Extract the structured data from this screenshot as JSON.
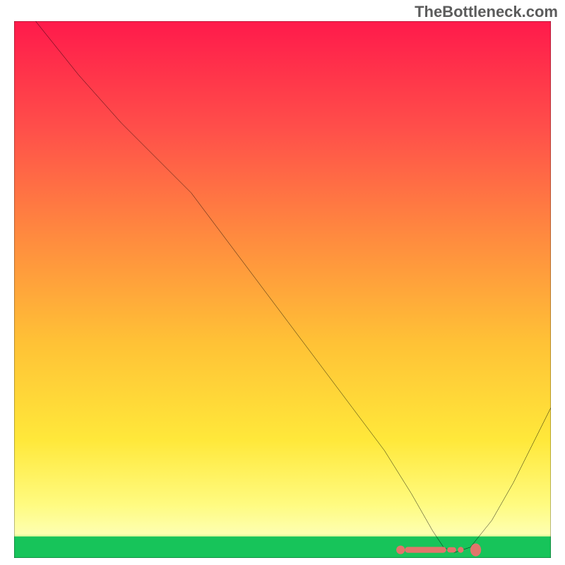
{
  "watermark": "TheBottleneck.com",
  "chart_data": {
    "type": "line",
    "title": "",
    "xlabel": "",
    "ylabel": "",
    "xlim": [
      0,
      100
    ],
    "ylim": [
      0,
      100
    ],
    "grid": false,
    "series": [
      {
        "name": "curve",
        "x": [
          0,
          4,
          12,
          20,
          27,
          33,
          39,
          45,
          51,
          57,
          63,
          69,
          74,
          78,
          80,
          82,
          85,
          89,
          93,
          100
        ],
        "y": [
          105,
          100,
          90,
          81,
          74,
          68,
          60,
          52,
          44,
          36,
          28,
          20,
          12,
          5,
          2,
          1,
          2,
          7,
          14,
          28
        ]
      }
    ],
    "green_band": {
      "y_start": 0,
      "y_end": 4
    },
    "markers": {
      "x_start": 72,
      "x_end": 86,
      "y": 1.5
    },
    "gradient_stops": [
      {
        "offset": 0.0,
        "color": "#ff1a4b"
      },
      {
        "offset": 0.2,
        "color": "#ff4f4a"
      },
      {
        "offset": 0.4,
        "color": "#ff8a3f"
      },
      {
        "offset": 0.6,
        "color": "#ffc236"
      },
      {
        "offset": 0.78,
        "color": "#ffe83a"
      },
      {
        "offset": 0.9,
        "color": "#fffb80"
      },
      {
        "offset": 0.955,
        "color": "#fdffb0"
      },
      {
        "offset": 0.97,
        "color": "#9fe86e"
      },
      {
        "offset": 1.0,
        "color": "#17c45a"
      }
    ]
  }
}
